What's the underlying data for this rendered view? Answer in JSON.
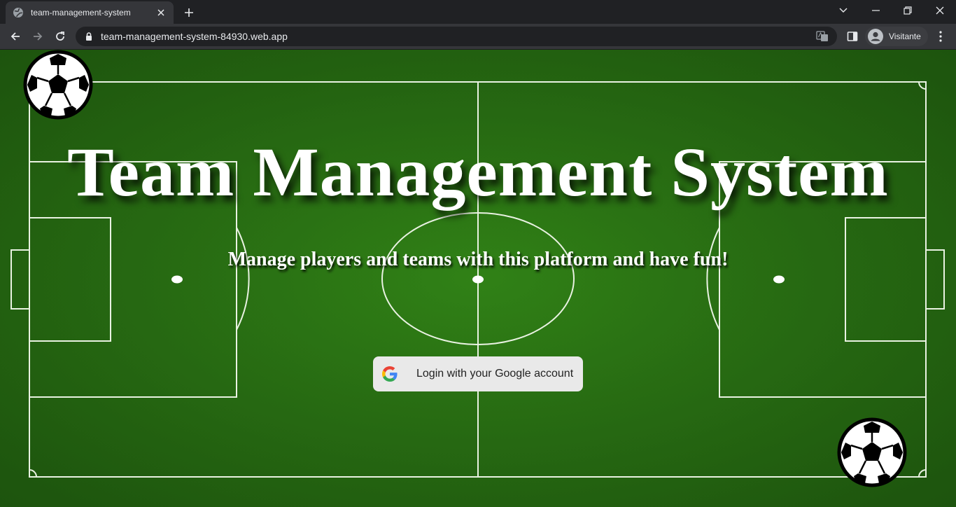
{
  "browser": {
    "tab_title": "team-management-system",
    "url": "team-management-system-84930.web.app",
    "profile_name": "Visitante"
  },
  "page": {
    "headline": "Team Management System",
    "subtitle": "Manage players and teams with this platform and have fun!",
    "login_button_label": "Login with your Google account"
  },
  "icons": {
    "favicon": "globe-icon",
    "login": "google-g-icon",
    "decoration": "soccer-ball-icon"
  },
  "colors": {
    "pitch_green": "#2a7013",
    "line_white": "#ffffff",
    "button_bg": "#e9e9e9",
    "chrome_dark": "#202124",
    "chrome_toolbar": "#35363a"
  }
}
